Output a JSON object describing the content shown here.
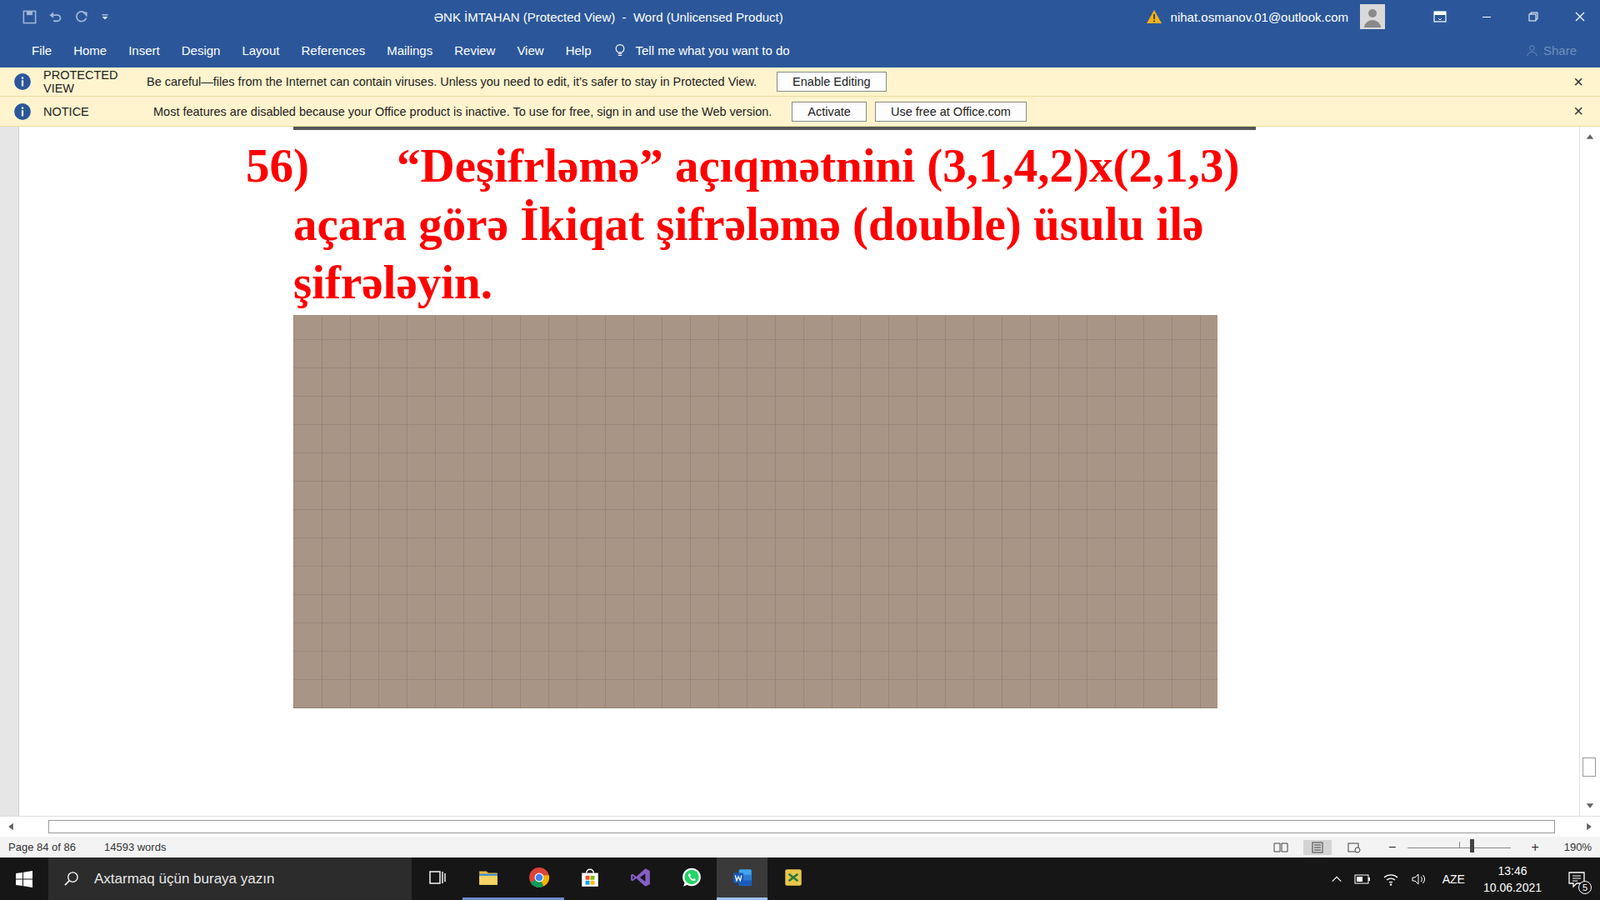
{
  "window": {
    "title": "ƏNK İMTAHAN (Protected View)  -  Word (Unlicensed Product)",
    "account": "nihat.osmanov.01@outlook.com"
  },
  "ribbon": {
    "tabs": [
      {
        "label": "File",
        "selected": false
      },
      {
        "label": "Home",
        "selected": false
      },
      {
        "label": "Insert",
        "selected": false
      },
      {
        "label": "Design",
        "selected": false
      },
      {
        "label": "Layout",
        "selected": false
      },
      {
        "label": "References",
        "selected": false
      },
      {
        "label": "Mailings",
        "selected": false
      },
      {
        "label": "Review",
        "selected": false
      },
      {
        "label": "View",
        "selected": false
      },
      {
        "label": "Help",
        "selected": false
      }
    ],
    "tell_me": "Tell me what you want to do",
    "share": {
      "label": "Share",
      "disabled": true
    }
  },
  "message_bars": [
    {
      "title": "PROTECTED VIEW",
      "message": "Be careful—files from the Internet can contain viruses. Unless you need to edit, it’s safer to stay in Protected View.",
      "buttons": [
        "Enable Editing"
      ],
      "close": "×"
    },
    {
      "title": "NOTICE",
      "message": "Most features are disabled because your Office product is inactive. To use for free, sign in and use the Web version.",
      "buttons": [
        "Activate",
        "Use free at Office.com"
      ],
      "close": "×"
    }
  ],
  "document": {
    "number": "56)",
    "lines": [
      "“Deşifrləmə” açıqmətnini (3,1,4,2)x(2,1,3)",
      "açara görə İkiqat şifrələmə (double) üsulu ilə",
      "şifrələyin."
    ]
  },
  "vertical_scrollbar": {
    "level": 0.97
  },
  "horizontal_scrollbar": {
    "level": 0.97
  },
  "status_bar": {
    "page": "Page 84 of 86",
    "words": "14593 words",
    "zoom_minus": "−",
    "zoom_plus": "+",
    "zoom": "190%",
    "zoom_level": 0.6
  },
  "taskbar": {
    "search_placeholder": "Axtarmaq üçün buraya yazın",
    "apps": [
      {
        "kind": "taskview",
        "running": false,
        "selected": false
      },
      {
        "kind": "explorer",
        "running": true,
        "selected": false
      },
      {
        "kind": "chrome",
        "running": true,
        "selected": false
      },
      {
        "kind": "store",
        "running": false,
        "selected": false
      },
      {
        "kind": "vs",
        "running": false,
        "selected": false
      },
      {
        "kind": "whatsapp",
        "running": false,
        "selected": false
      },
      {
        "kind": "word",
        "running": true,
        "selected": true
      },
      {
        "kind": "other",
        "running": false,
        "selected": false
      }
    ],
    "language": "AZE",
    "time": "13:46",
    "date": "10.06.2021",
    "notifications": "5"
  }
}
